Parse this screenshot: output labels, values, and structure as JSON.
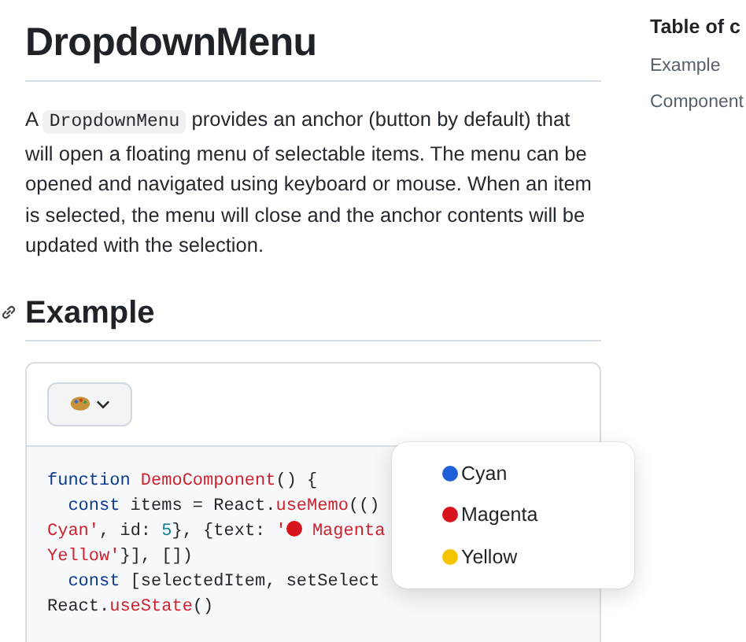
{
  "page": {
    "title": "DropdownMenu",
    "intro": {
      "before": "A ",
      "code": "DropdownMenu",
      "after": " provides an anchor (button by default) that will open a floating menu of selectable items. The menu can be opened and navigated using keyboard or mouse. When an item is selected, the menu will close and the anchor contents will be updated with the selection."
    },
    "section_heading": "Example"
  },
  "example": {
    "anchor_button": {
      "expanded": true
    },
    "code_lines": [
      [
        {
          "kind": "keyword",
          "text": "function "
        },
        {
          "kind": "fn",
          "text": "DemoComponent"
        },
        {
          "kind": "plain",
          "text": "() {"
        }
      ],
      [
        {
          "kind": "indent"
        },
        {
          "kind": "keyword",
          "text": "const "
        },
        {
          "kind": "plain",
          "text": "items = React."
        },
        {
          "kind": "fn",
          "text": "useMemo"
        },
        {
          "kind": "plain",
          "text": "(()"
        }
      ],
      [
        {
          "kind": "string",
          "text": "Cyan'"
        },
        {
          "kind": "plain",
          "text": ", id: "
        },
        {
          "kind": "number",
          "text": "5"
        },
        {
          "kind": "plain",
          "text": "}, {text: "
        },
        {
          "kind": "string",
          "text": "'"
        },
        {
          "kind": "dot",
          "color": "#d8141c"
        },
        {
          "kind": "string",
          "text": " Magenta"
        }
      ],
      [
        {
          "kind": "string",
          "text": "Yellow'"
        },
        {
          "kind": "plain",
          "text": "}], [])"
        }
      ],
      [
        {
          "kind": "indent"
        },
        {
          "kind": "keyword",
          "text": "const "
        },
        {
          "kind": "plain",
          "text": "[selectedItem, setSelect"
        }
      ],
      [
        {
          "kind": "plain",
          "text": "React."
        },
        {
          "kind": "fn",
          "text": "useState"
        },
        {
          "kind": "plain",
          "text": "()"
        }
      ]
    ],
    "menu_items": [
      {
        "label": "Cyan",
        "color": "#1d5fd6"
      },
      {
        "label": "Magenta",
        "color": "#d8141c"
      },
      {
        "label": "Yellow",
        "color": "#f5c400"
      }
    ]
  },
  "sidebar": {
    "heading": "Table of c",
    "items": [
      "Example",
      "Component"
    ]
  }
}
